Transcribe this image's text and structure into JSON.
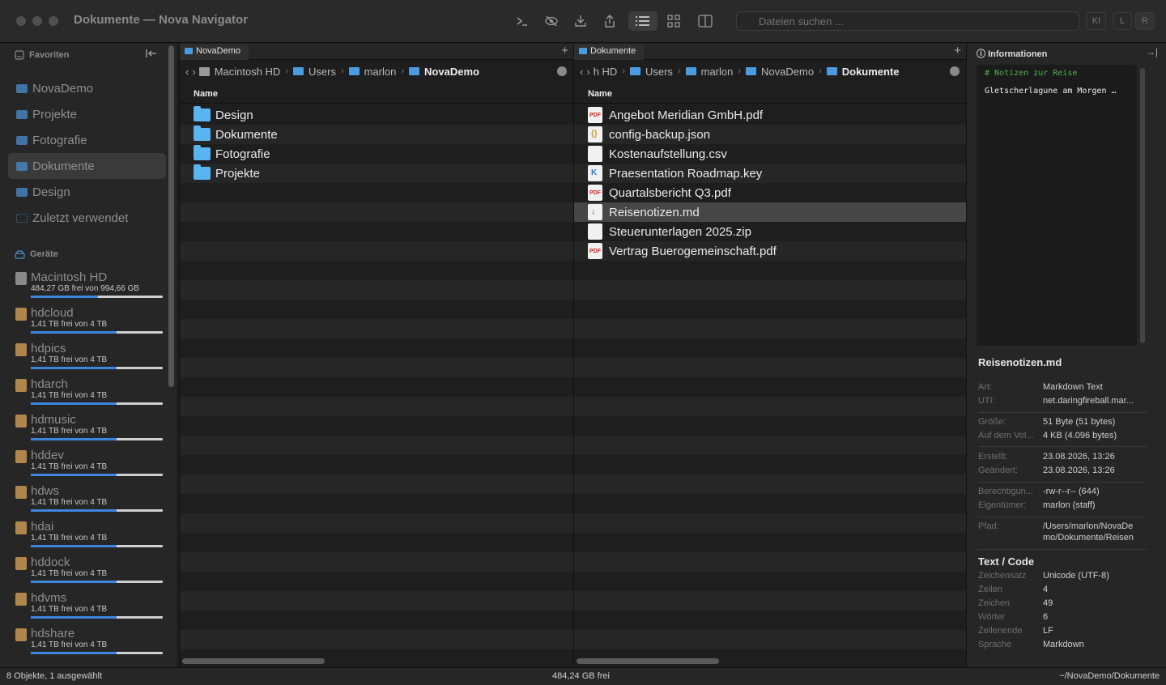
{
  "window": {
    "title": "Dokumente — Nova Navigator"
  },
  "toolbar": {
    "search_placeholder": "Dateien suchen ...",
    "ki_label": "KI",
    "l_label": "L",
    "r_label": "R"
  },
  "sidebar": {
    "favorites_header": "Favoriten",
    "favorites": [
      {
        "label": "NovaDemo"
      },
      {
        "label": "Projekte"
      },
      {
        "label": "Fotografie"
      },
      {
        "label": "Dokumente",
        "selected": true
      },
      {
        "label": "Design"
      },
      {
        "label": "Zuletzt verwendet"
      }
    ],
    "devices_header": "Geräte",
    "devices": [
      {
        "name": "Macintosh HD",
        "free": "484,27 GB frei von 994,66 GB",
        "used_fraction": 0.51
      },
      {
        "name": "hdcloud",
        "free": "1,41 TB frei von 4 TB",
        "used_fraction": 0.65
      },
      {
        "name": "hdpics",
        "free": "1,41 TB frei von 4 TB",
        "used_fraction": 0.65
      },
      {
        "name": "hdarch",
        "free": "1,41 TB frei von 4 TB",
        "used_fraction": 0.65
      },
      {
        "name": "hdmusic",
        "free": "1,41 TB frei von 4 TB",
        "used_fraction": 0.65
      },
      {
        "name": "hddev",
        "free": "1,41 TB frei von 4 TB",
        "used_fraction": 0.65
      },
      {
        "name": "hdws",
        "free": "1,41 TB frei von 4 TB",
        "used_fraction": 0.65
      },
      {
        "name": "hdai",
        "free": "1,41 TB frei von 4 TB",
        "used_fraction": 0.65
      },
      {
        "name": "hddock",
        "free": "1,41 TB frei von 4 TB",
        "used_fraction": 0.65
      },
      {
        "name": "hdvms",
        "free": "1,41 TB frei von 4 TB",
        "used_fraction": 0.65
      },
      {
        "name": "hdshare",
        "free": "1,41 TB frei von 4 TB",
        "used_fraction": 0.65
      }
    ]
  },
  "left_pane": {
    "tab": "NovaDemo",
    "breadcrumb": [
      "Macintosh HD",
      "Users",
      "marlon",
      "NovaDemo"
    ],
    "column": "Name",
    "items": [
      "Design",
      "Dokumente",
      "Fotografie",
      "Projekte"
    ]
  },
  "right_pane": {
    "tab": "Dokumente",
    "breadcrumb": [
      "h HD",
      "Users",
      "marlon",
      "NovaDemo",
      "Dokumente"
    ],
    "column": "Name",
    "items": [
      {
        "name": "Angebot Meridian GmbH.pdf",
        "icon": "pdf-icon"
      },
      {
        "name": "config-backup.json",
        "icon": "json-icon"
      },
      {
        "name": "Kostenaufstellung.csv",
        "icon": "csv-icon"
      },
      {
        "name": "Praesentation Roadmap.key",
        "icon": "keynote-icon"
      },
      {
        "name": "Quartalsbericht Q3.pdf",
        "icon": "pdf-icon"
      },
      {
        "name": "Reisenotizen.md",
        "icon": "markdown-icon",
        "selected": true
      },
      {
        "name": "Steuerunterlagen 2025.zip",
        "icon": "zip-icon"
      },
      {
        "name": "Vertrag Buerogemeinschaft.pdf",
        "icon": "pdf-icon"
      }
    ]
  },
  "info": {
    "header": "Informationen",
    "preview_line1": "# Notizen zur Reise",
    "preview_line2": "Gletscherlagune am Morgen …",
    "filename": "Reisenotizen.md",
    "props": [
      {
        "k": "Art:",
        "v": "Markdown Text"
      },
      {
        "k": "UTI:",
        "v": "net.daringfireball.mar..."
      },
      {
        "k": "Größe:",
        "v": "51 Byte (51 bytes)"
      },
      {
        "k": "Auf dem Vol...",
        "v": "4 KB (4.096 bytes)"
      },
      {
        "k": "Erstellt:",
        "v": "23.08.2026, 13:26"
      },
      {
        "k": "Geändert:",
        "v": "23.08.2026, 13:26"
      },
      {
        "k": "Berechtigun...",
        "v": "-rw-r--r-- (644)"
      },
      {
        "k": "Eigentümer:",
        "v": "marlon (staff)"
      },
      {
        "k": "Pfad:",
        "v": "/Users/marlon/NovaDe"
      },
      {
        "k": "",
        "v": "mo/Dokumente/Reisen"
      }
    ],
    "text_section": "Text / Code",
    "text_props": [
      {
        "k": "Zeichensatz",
        "v": "Unicode (UTF-8)"
      },
      {
        "k": "Zeilen",
        "v": "4"
      },
      {
        "k": "Zeichen",
        "v": "49"
      },
      {
        "k": "Wörter",
        "v": "6"
      },
      {
        "k": "Zeilenende",
        "v": "LF"
      },
      {
        "k": "Sprache",
        "v": "Markdown"
      }
    ]
  },
  "status": {
    "left": "8 Objekte, 1 ausgewählt",
    "center": "484,24 GB frei",
    "right": "~/NovaDemo/Dokumente"
  }
}
